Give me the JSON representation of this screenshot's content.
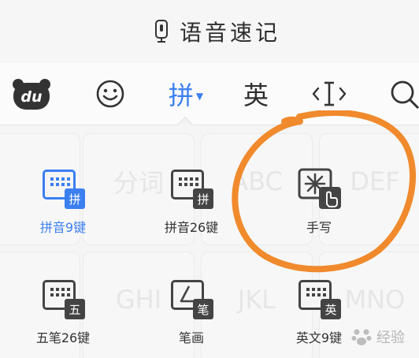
{
  "voice_bar": {
    "label": "语音速记",
    "mic_icon": "microphone-icon"
  },
  "toolbar": {
    "logo_text": "du",
    "pinyin_label": "拼",
    "english_label": "英",
    "active_color": "#3b7ff0"
  },
  "ghost_keys": [
    "分词",
    "ABC",
    "DEF",
    "GHI",
    "JKL",
    "MNO"
  ],
  "input_methods": [
    {
      "name": "拼音9键",
      "badge": "拼"
    },
    {
      "name": "拼音26键",
      "badge": "拼"
    },
    {
      "name": "手写"
    },
    {
      "name": "五笔26键",
      "badge": "五"
    },
    {
      "name": "笔画",
      "badge": "笔"
    },
    {
      "name": "英文9键",
      "badge": "英"
    }
  ],
  "annotation_color": "#f08a2c",
  "watermark": {
    "text": "经验"
  }
}
